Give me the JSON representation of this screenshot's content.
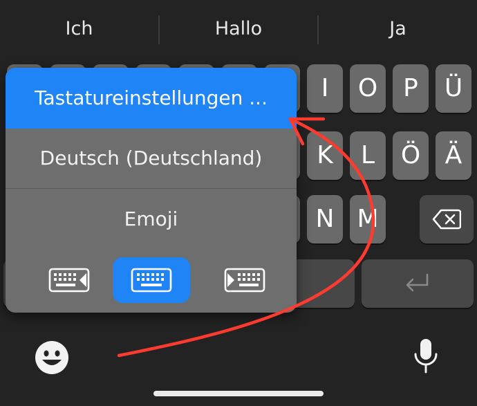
{
  "suggestions": [
    "Ich",
    "Hallo",
    "Ja"
  ],
  "keys": {
    "row1": [
      "I",
      "O",
      "P",
      "Ü"
    ],
    "row2": [
      "K",
      "L",
      "Ö",
      "Ä"
    ],
    "row3": [
      "N",
      "M"
    ]
  },
  "popup": {
    "items": [
      "Tastatureinstellungen ...",
      "Deutsch (Deutschland)",
      "Emoji"
    ],
    "selected_index": 0
  },
  "icons": {
    "emoji": "emoji-smile-icon",
    "mic": "microphone-icon",
    "backspace": "backspace-icon",
    "return": "return-icon",
    "keyboard_left": "keyboard-left-icon",
    "keyboard_center": "keyboard-icon",
    "keyboard_right": "keyboard-right-icon"
  },
  "colors": {
    "accent": "#1f84f5",
    "annotation_arrow": "#ff3b30",
    "background": "#232323"
  }
}
